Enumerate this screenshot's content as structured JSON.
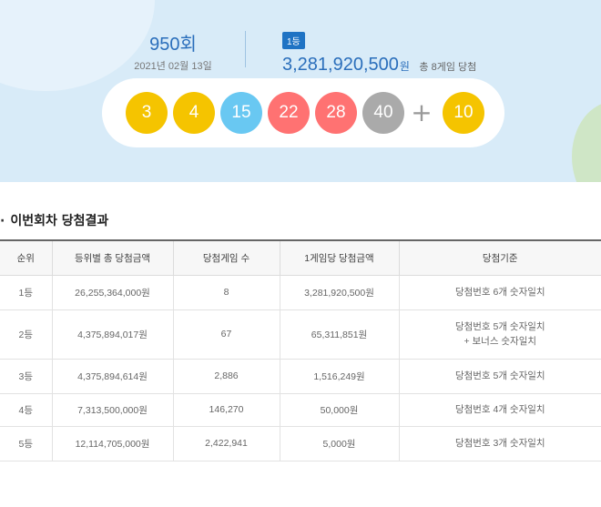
{
  "draw": {
    "round_number": "950",
    "round_suffix": "회",
    "date": "2021년 02월 13일",
    "first_prize": {
      "badge": "1등",
      "amount": "3,281,920,500",
      "unit": "원",
      "winners_text": "총 8게임 당첨"
    },
    "numbers": [
      {
        "value": "3",
        "color": "#f5c400"
      },
      {
        "value": "4",
        "color": "#f5c400"
      },
      {
        "value": "15",
        "color": "#69c8f2"
      },
      {
        "value": "22",
        "color": "#ff7272"
      },
      {
        "value": "28",
        "color": "#ff7272"
      },
      {
        "value": "40",
        "color": "#aaaaaa"
      }
    ],
    "plus_symbol": "+",
    "bonus": {
      "value": "10",
      "color": "#f5c400"
    }
  },
  "section": {
    "bullet": "·",
    "title": "이번회차 당첨결과"
  },
  "table": {
    "headers": [
      "순위",
      "등위별 총 당첨금액",
      "당첨게임 수",
      "1게임당 당첨금액",
      "당첨기준"
    ],
    "rows": [
      {
        "rank": "1등",
        "total": "26,255,364,000원",
        "games": "8",
        "per_game": "3,281,920,500원",
        "criteria": [
          "당첨번호 6개 숫자일치"
        ]
      },
      {
        "rank": "2등",
        "total": "4,375,894,017원",
        "games": "67",
        "per_game": "65,311,851원",
        "criteria": [
          "당첨번호 5개 숫자일치",
          "+ 보너스 숫자일치"
        ]
      },
      {
        "rank": "3등",
        "total": "4,375,894,614원",
        "games": "2,886",
        "per_game": "1,516,249원",
        "criteria": [
          "당첨번호 5개 숫자일치"
        ]
      },
      {
        "rank": "4등",
        "total": "7,313,500,000원",
        "games": "146,270",
        "per_game": "50,000원",
        "criteria": [
          "당첨번호 4개 숫자일치"
        ]
      },
      {
        "rank": "5등",
        "total": "12,114,705,000원",
        "games": "2,422,941",
        "per_game": "5,000원",
        "criteria": [
          "당첨번호 3개 숫자일치"
        ]
      }
    ]
  }
}
